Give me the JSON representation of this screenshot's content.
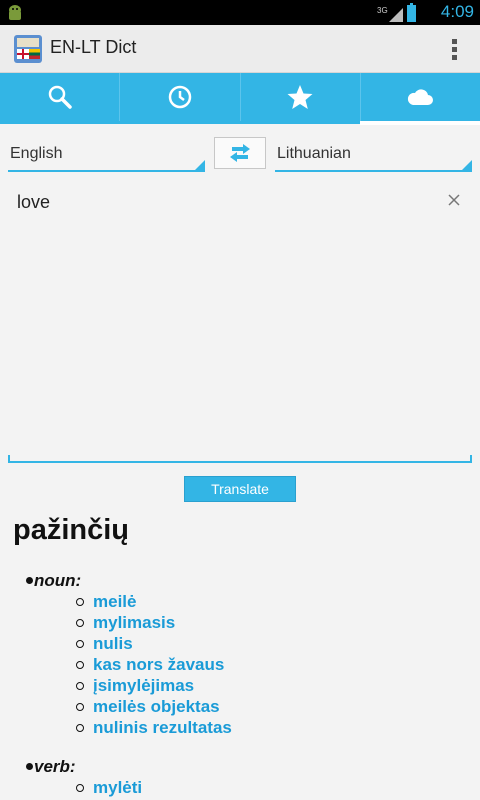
{
  "status_bar": {
    "network": "3G",
    "time": "4:09",
    "battery_color": "#33b5e5"
  },
  "app": {
    "title": "EN-LT Dict"
  },
  "tabs": [
    {
      "icon": "search-icon",
      "active": false
    },
    {
      "icon": "history-clock-icon",
      "active": false
    },
    {
      "icon": "star-icon",
      "active": false
    },
    {
      "icon": "cloud-icon",
      "active": true
    }
  ],
  "languages": {
    "source": "English",
    "target": "Lithuanian"
  },
  "input": {
    "value": "love"
  },
  "translate_button": "Translate",
  "result": {
    "word": "pažinčių",
    "sections": [
      {
        "pos": "noun:",
        "translations": [
          "meilė",
          "mylimasis",
          "nulis",
          "kas nors žavaus",
          "įsimylėjimas",
          "meilės objektas",
          "nulinis rezultatas"
        ]
      },
      {
        "pos": "verb:",
        "translations": [
          "mylėti"
        ]
      }
    ]
  },
  "colors": {
    "accent": "#33b5e5",
    "link": "#1a9bd7"
  }
}
